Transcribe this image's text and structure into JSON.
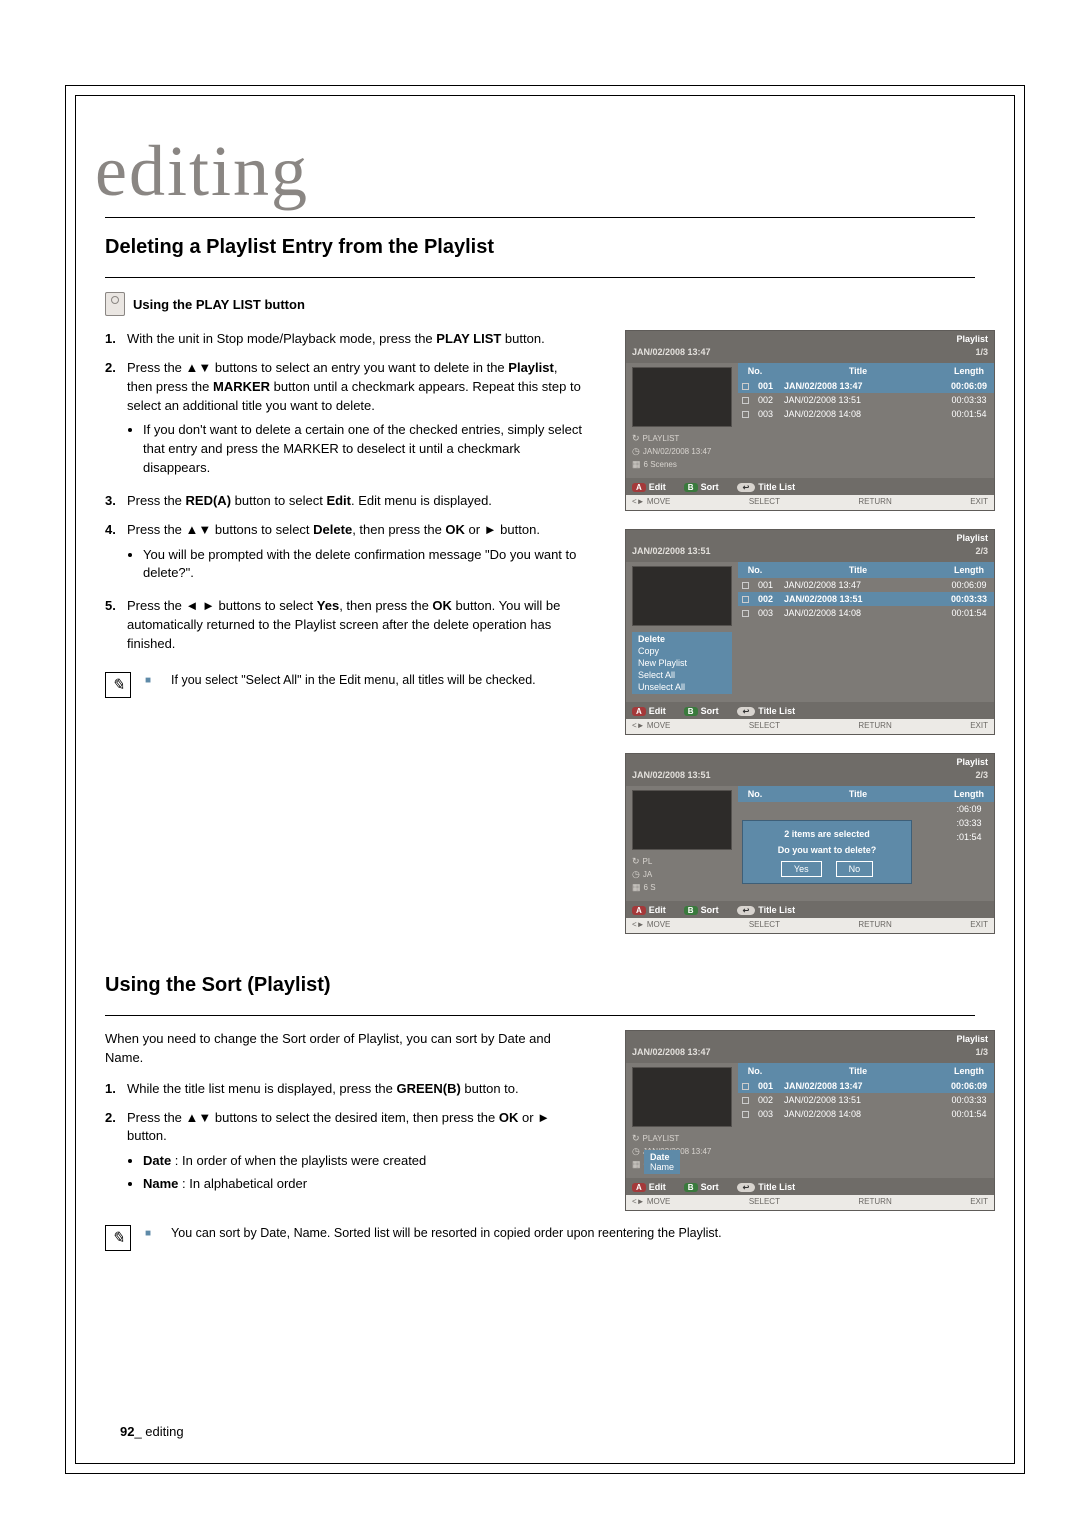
{
  "chapter": "editing",
  "section1": {
    "title": "Deleting a Playlist Entry from the Playlist",
    "subhead": "Using the PLAY LIST button",
    "steps": [
      "With the unit in Stop mode/Playback mode, press the <b>PLAY LIST</b> button.",
      "Press the ▲▼ buttons to select an entry you want to delete in the <b>Playlist</b>, then press the <b>MARKER</b> button until a checkmark appears. Repeat this step to select an additional title you want to delete.",
      "Press the <b>RED(A)</b> button to select <b>Edit</b>. Edit menu is displayed.",
      "Press the ▲▼ buttons to select <b>Delete</b>, then press the <b>OK</b> or ► button.",
      "Press the ◄ ► buttons to select <b>Yes</b>, then press the <b>OK</b> button. You will be automatically returned to the Playlist screen after the delete operation has finished."
    ],
    "sub2a": "If you don't want to delete a certain one of the checked entries, simply select that entry and press the MARKER to deselect it until a checkmark disappears.",
    "sub4a": "You will be prompted with the delete confirmation message \"Do you want to delete?\".",
    "note": "If you select \"Select All\" in the Edit menu, all titles will be checked."
  },
  "section2": {
    "title": "Using the Sort (Playlist)",
    "intro": "When you need to change the Sort order of Playlist, you can sort by Date and  Name.",
    "steps": [
      "While the title list menu is displayed, press the <b>GREEN(B)</b> button to.",
      "Press the ▲▼ buttons to select the desired item, then press the <b>OK</b> or ► button."
    ],
    "sub2a": "<b>Date</b> : In order of when the playlists were created",
    "sub2b": "<b>Name</b> : In alphabetical order",
    "note": "You can sort by Date, Name. Sorted list will be resorted in copied order upon reentering the Playlist."
  },
  "shots": {
    "playlist_label": "Playlist",
    "cols": {
      "no": "No.",
      "title": "Title",
      "length": "Length"
    },
    "toolbar": {
      "edit": "Edit",
      "sort": "Sort",
      "titlelist": "Title List"
    },
    "footer": {
      "move": "<► MOVE",
      "select": "SELECT",
      "return": "RETURN",
      "exit": "EXIT"
    },
    "meta_playlist": "PLAYLIST",
    "scenes": "6 Scenes",
    "s1": {
      "counter": "1/3",
      "status": "JAN/02/2008 13:47",
      "time": "JAN/02/2008 13:47",
      "rows": [
        {
          "no": "001",
          "title": "JAN/02/2008 13:47",
          "len": "00:06:09"
        },
        {
          "no": "002",
          "title": "JAN/02/2008 13:51",
          "len": "00:03:33"
        },
        {
          "no": "003",
          "title": "JAN/02/2008 14:08",
          "len": "00:01:54"
        }
      ]
    },
    "s2": {
      "counter": "2/3",
      "status": "JAN/02/2008 13:51",
      "menu": [
        "Delete",
        "Copy",
        "New Playlist",
        "Select All",
        "Unselect All"
      ]
    },
    "s3": {
      "counter": "2/3",
      "status": "JAN/02/2008 13:51",
      "dialog_msg1": "2 items are selected",
      "dialog_msg2": "Do you want to delete?",
      "yes": "Yes",
      "no": "No",
      "len_only": [
        ":06:09",
        ":03:33",
        ":01:54"
      ]
    },
    "s4": {
      "counter": "1/3",
      "status": "JAN/02/2008 13:47",
      "time": "JAN/02/2008 13:47",
      "sort_opts": [
        "Date",
        "Name"
      ]
    }
  },
  "page_number": "92",
  "page_label": "_ editing"
}
